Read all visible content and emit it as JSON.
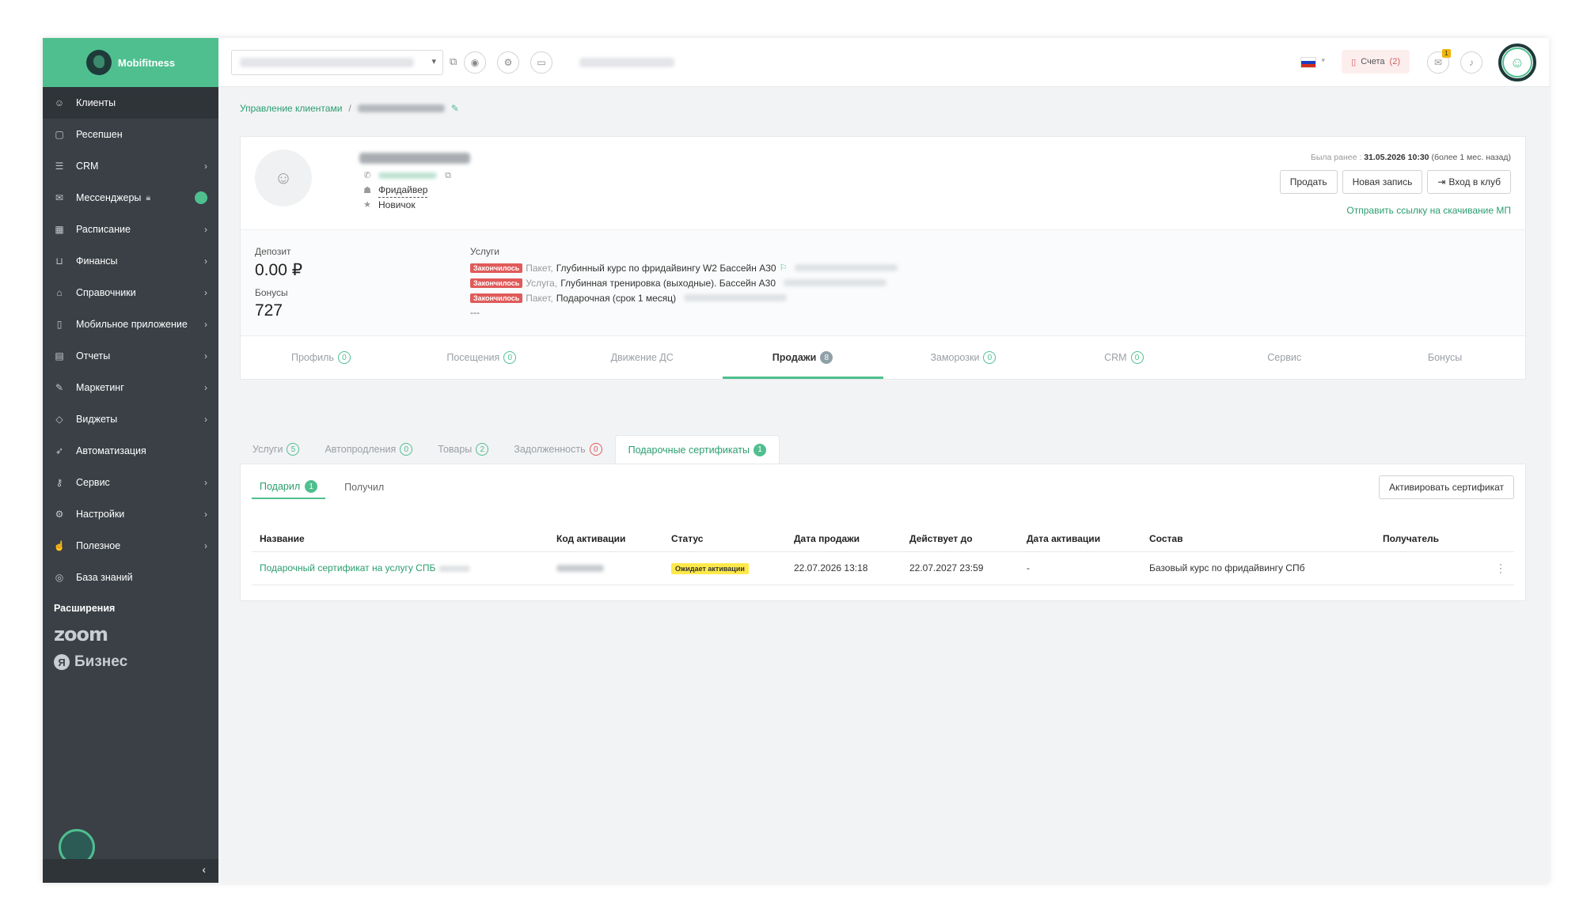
{
  "brand": {
    "name": "Mobifitness"
  },
  "sidebar": {
    "items": [
      {
        "label": "Клиенты",
        "icon": "users-icon",
        "glyph": "☺"
      },
      {
        "label": "Ресепшен",
        "icon": "reception-icon",
        "glyph": "▢"
      },
      {
        "label": "CRM",
        "icon": "list-icon",
        "glyph": "☰"
      },
      {
        "label": "Мессенджеры",
        "icon": "chat-icon",
        "glyph": "✉"
      },
      {
        "label": "Расписание",
        "icon": "calendar-icon",
        "glyph": "▦"
      },
      {
        "label": "Финансы",
        "icon": "cart-icon",
        "glyph": "⊔"
      },
      {
        "label": "Справочники",
        "icon": "home-icon",
        "glyph": "⌂"
      },
      {
        "label": "Мобильное приложение",
        "icon": "phone-icon",
        "glyph": "▯"
      },
      {
        "label": "Отчеты",
        "icon": "report-icon",
        "glyph": "▤"
      },
      {
        "label": "Маркетинг",
        "icon": "megaphone-icon",
        "glyph": "✎"
      },
      {
        "label": "Виджеты",
        "icon": "tag-icon",
        "glyph": "◇"
      },
      {
        "label": "Автоматизация",
        "icon": "rocket-icon",
        "glyph": "➶"
      },
      {
        "label": "Сервис",
        "icon": "key-icon",
        "glyph": "⚷"
      },
      {
        "label": "Настройки",
        "icon": "gear-icon",
        "glyph": "⚙"
      },
      {
        "label": "Полезное",
        "icon": "thumbs-up-icon",
        "glyph": "☝"
      },
      {
        "label": "База знаний",
        "icon": "lifebuoy-icon",
        "glyph": "◎"
      }
    ],
    "extensions_title": "Расширения",
    "zoom_label": "zoom",
    "yandex_badge": "Я",
    "yandex_label": "Бизнес",
    "collapse_glyph": "‹"
  },
  "topbar": {
    "bills_label": "Счета",
    "bills_count": "(2)",
    "flag_colors": [
      "#ffffff",
      "#1c3fbf",
      "#d52b1e"
    ],
    "notif_badge": "1"
  },
  "breadcrumb": {
    "root": "Управление клиентами",
    "sep": "/"
  },
  "client": {
    "tag": "Фридайвер",
    "level": "Новичок",
    "prev_visit_label": "Была ранее :",
    "prev_visit_value": "31.05.2026 10:30",
    "prev_visit_note": "(более 1 мес. назад)",
    "actions": {
      "sell": "Продать",
      "new_booking": "Новая запись",
      "enter_club": "Вход в клуб"
    },
    "app_link": "Отправить ссылку на скачивание МП",
    "deposit_label": "Депозит",
    "deposit_value": "0.00 ₽",
    "bonus_label": "Бонусы",
    "bonus_value": "727",
    "services_label": "Услуги",
    "services": [
      {
        "status": "Закончилось",
        "type": "Пакет,",
        "name": "Глубинный курс по фридайвингу W2 Бассейн А30"
      },
      {
        "status": "Закончилось",
        "type": "Услуга,",
        "name": "Глубинная тренировка (выходные). Бассейн А30"
      },
      {
        "status": "Закончилось",
        "type": "Пакет,",
        "name": "Подарочная (срок 1 месяц)"
      }
    ],
    "services_more": "---"
  },
  "tabs": [
    {
      "label": "Профиль",
      "count": "0"
    },
    {
      "label": "Посещения",
      "count": "0"
    },
    {
      "label": "Движение ДС",
      "count": ""
    },
    {
      "label": "Продажи",
      "count": "8"
    },
    {
      "label": "Заморозки",
      "count": "0"
    },
    {
      "label": "CRM",
      "count": "0"
    },
    {
      "label": "Сервис",
      "count": ""
    },
    {
      "label": "Бонусы",
      "count": ""
    }
  ],
  "subtabs": [
    {
      "label": "Услуги",
      "count": "5"
    },
    {
      "label": "Автопродления",
      "count": "0"
    },
    {
      "label": "Товары",
      "count": "2"
    },
    {
      "label": "Задолженность",
      "count": "0"
    },
    {
      "label": "Подарочные сертификаты",
      "count": "1"
    }
  ],
  "pills": [
    {
      "label": "Подарил",
      "count": "1"
    },
    {
      "label": "Получил",
      "count": ""
    }
  ],
  "activate_label": "Активировать сертификат",
  "table": {
    "headers": [
      "Название",
      "Код активации",
      "Статус",
      "Дата продажи",
      "Действует до",
      "Дата активации",
      "Состав",
      "Получатель"
    ],
    "rows": [
      {
        "name": "Подарочный сертификат на услугу СПБ",
        "status": "Ожидает активации",
        "sale_date": "22.07.2026 13:18",
        "valid_until": "22.07.2027 23:59",
        "activation_date": "-",
        "composition": "Базовый курс по фридайвингу СПб",
        "recipient": ""
      }
    ]
  }
}
